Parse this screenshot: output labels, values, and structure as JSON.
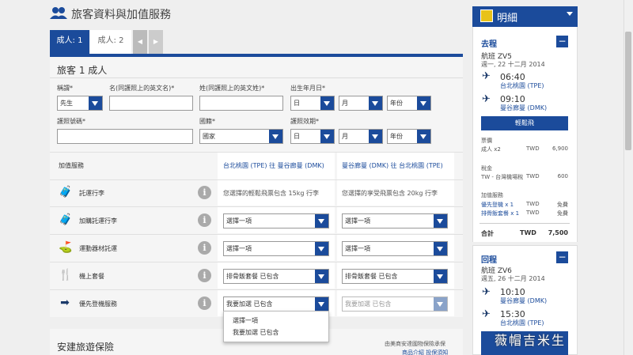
{
  "header": {
    "title": "旅客資料與加值服務"
  },
  "tabs": [
    {
      "label": "成人: 1"
    },
    {
      "label": "成人: 2"
    }
  ],
  "passenger": {
    "title": "旅客 1 成人",
    "fields": {
      "title_label": "稱謂*",
      "title_value": "先生",
      "given_name_label": "名(同護照上的英文名)*",
      "surname_label": "姓(同護照上的英文姓)*",
      "dob_label": "出生年月日*",
      "passport_label": "護照號碼*",
      "nationality_label": "國籍*",
      "nationality_value": "國家",
      "expiry_label": "護照效期*",
      "day": "日",
      "month": "月",
      "year": "年份"
    }
  },
  "services": {
    "header_label": "加值服務",
    "col1": "台北桃園 (TPE) 往 曼谷廊曼 (DMK)",
    "col2": "曼谷廊曼 (DMK) 往 台北桃園 (TPE)",
    "rows": [
      {
        "name": "託運行李",
        "v1": "您選擇的輕鬆飛票包含 15kg 行李",
        "v2": "您選擇的享受飛票包含 20kg 行李"
      },
      {
        "name": "加購託運行李",
        "v1": "選擇一項",
        "v2": "選擇一項"
      },
      {
        "name": "運動器材託運",
        "v1": "選擇一項",
        "v2": "選擇一項"
      },
      {
        "name": "機上套餐",
        "v1": "排骨飯套餐 已包含",
        "v2": "排骨飯套餐 已包含"
      },
      {
        "name": "優先登機服務",
        "v1": "我要加選 已包含",
        "v2": "我要加選 已包含"
      }
    ],
    "dropdown_options": [
      "選擇一項",
      "我要加選 已包含"
    ]
  },
  "insurance": {
    "title": "安建旅遊保險",
    "note1": "由美商安達國物保險承保",
    "note2": "商品介紹 投保須知"
  },
  "summary": {
    "title": "明細",
    "outbound": {
      "label": "去程",
      "flight": "航班 ZV5",
      "date": "週一, 22 十二月 2014",
      "dep_time": "06:40",
      "dep_airport": "台北桃園 (TPE)",
      "arr_time": "09:10",
      "arr_airport": "曼谷廊曼 (DMK)",
      "fare_button": "輕鬆飛"
    },
    "fare": {
      "label": "票價",
      "pax": "成人 x2",
      "currency": "TWD",
      "amount": "6,900",
      "tax_label": "稅金",
      "tax_item": "TW - 台灣機場稅",
      "tax_currency": "TWD",
      "tax_amount": "600",
      "addon_label": "加值服務",
      "addon1": "優先登機 x 1",
      "addon1_currency": "TWD",
      "addon1_amount": "免費",
      "addon2": "排骨飯套餐 x 1",
      "addon2_currency": "TWD",
      "addon2_amount": "免費",
      "total_label": "合計",
      "total_currency": "TWD",
      "total_amount": "7,500"
    },
    "return": {
      "label": "回程",
      "flight": "航班 ZV6",
      "date": "週五, 26 十二月 2014",
      "dep_time": "10:10",
      "dep_airport": "曼谷廊曼 (DMK)",
      "arr_time": "15:30",
      "arr_airport": "台北桃園 (TPE)"
    }
  },
  "watermark": "薇帽吉米生"
}
